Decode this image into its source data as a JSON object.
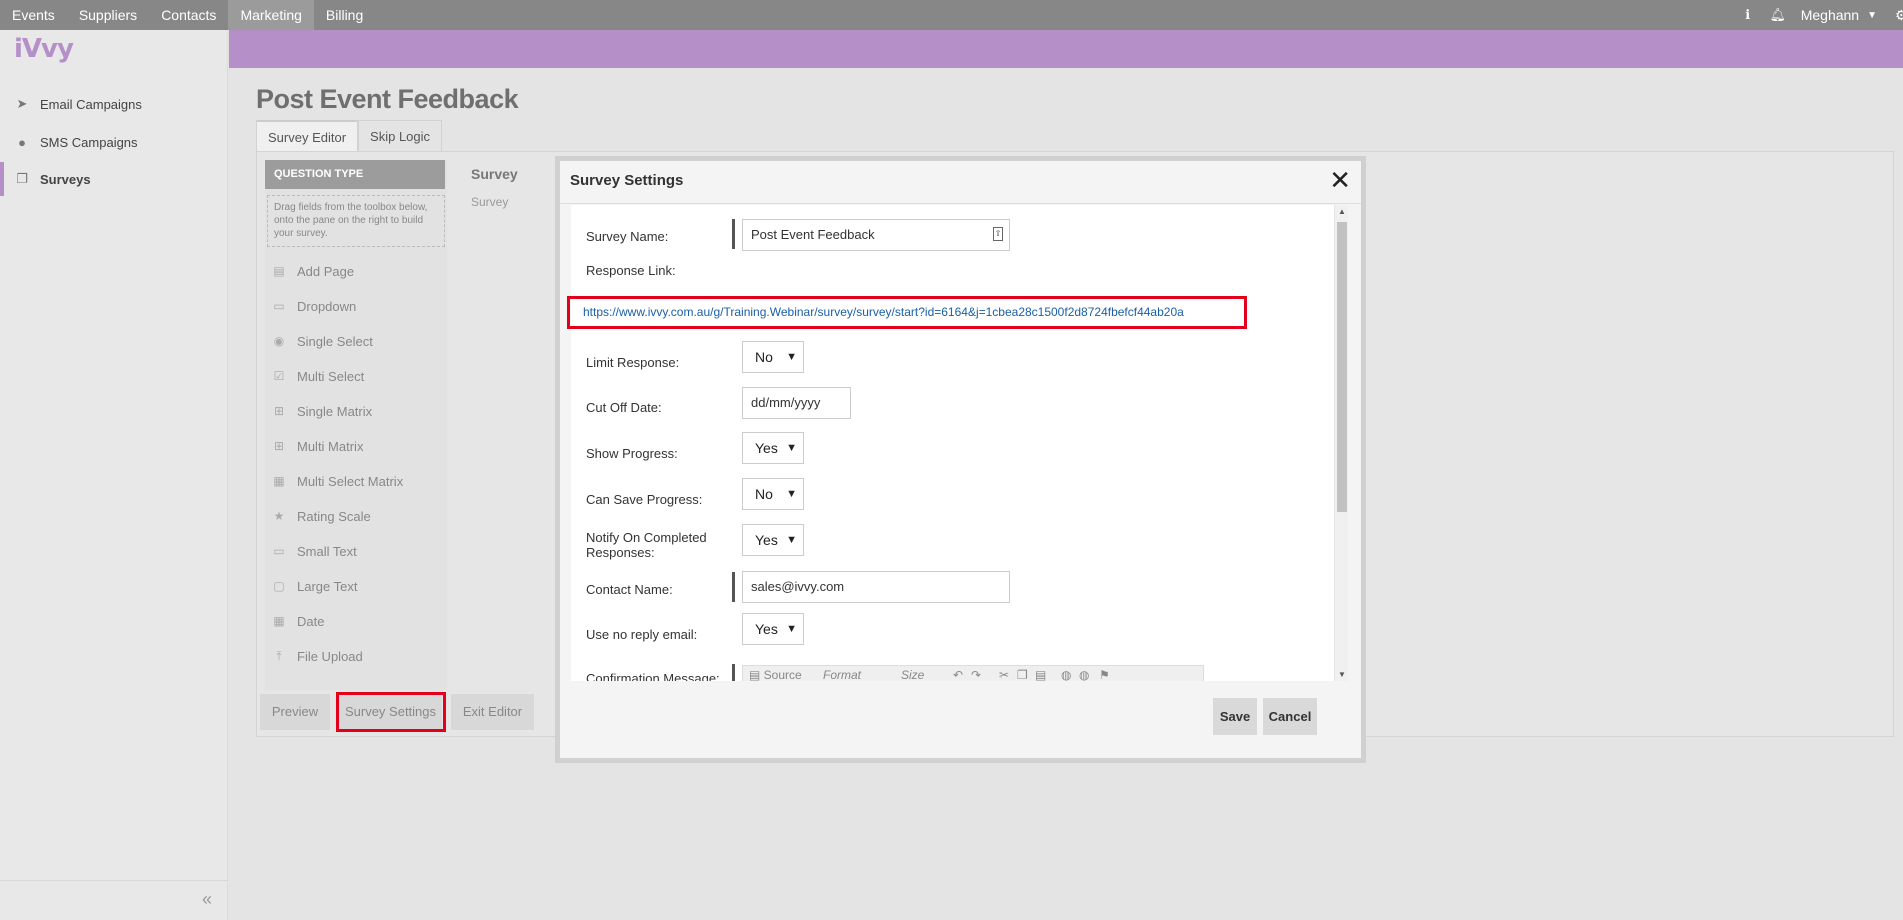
{
  "topnav": {
    "items": [
      "Events",
      "Suppliers",
      "Contacts",
      "Marketing",
      "Billing"
    ],
    "active": "Marketing",
    "user": "Meghann"
  },
  "sidebar": {
    "logo": "iVvy",
    "items": [
      {
        "label": "Email Campaigns",
        "icon": "paper-plane-icon"
      },
      {
        "label": "SMS Campaigns",
        "icon": "chat-bubble-icon"
      },
      {
        "label": "Surveys",
        "icon": "copy-icon",
        "active": true
      }
    ],
    "collapse": "«"
  },
  "page": {
    "title": "Post Event Feedback",
    "tabs": [
      "Survey Editor",
      "Skip Logic"
    ]
  },
  "toolbox": {
    "header": "QUESTION TYPE",
    "help": "Drag fields from the toolbox below, onto the pane on the right to build your survey.",
    "tools": [
      "Add Page",
      "Dropdown",
      "Single Select",
      "Multi Select",
      "Single Matrix",
      "Multi Matrix",
      "Multi Select Matrix",
      "Rating Scale",
      "Small Text",
      "Large Text",
      "Date",
      "File Upload"
    ]
  },
  "survey_col": {
    "title": "Survey",
    "subtitle": "Survey"
  },
  "bottom_buttons": {
    "preview": "Preview",
    "settings": "Survey Settings",
    "exit": "Exit Editor"
  },
  "modal": {
    "title": "Survey Settings",
    "close": "✕",
    "fields": {
      "survey_name_label": "Survey Name:",
      "survey_name_value": "Post Event Feedback",
      "response_link_label": "Response Link:",
      "response_link": "https://www.ivvy.com.au/g/Training.Webinar/survey/survey/start?id=6164&j=1cbea28c1500f2d8724fbefcf44ab20a",
      "limit_response_label": "Limit Response:",
      "limit_response_value": "No",
      "cut_off_label": "Cut Off Date:",
      "cut_off_placeholder": "dd/mm/yyyy",
      "show_progress_label": "Show Progress:",
      "show_progress_value": "Yes",
      "can_save_label": "Can Save Progress:",
      "can_save_value": "No",
      "notify_label_1": "Notify On Completed",
      "notify_label_2": "Responses:",
      "notify_value": "Yes",
      "contact_name_label": "Contact Name:",
      "contact_name_value": "sales@ivvy.com",
      "no_reply_label": "Use no reply email:",
      "no_reply_value": "Yes",
      "confirmation_label": "Confirmation Message:"
    },
    "editor_toolbar": {
      "source": "Source",
      "format": "Format",
      "size": "Size"
    },
    "save": "Save",
    "cancel": "Cancel"
  },
  "colors": {
    "brand_purple": "#b48fc8",
    "highlight_red": "#e2001a",
    "link_blue": "#1a5fa8"
  }
}
